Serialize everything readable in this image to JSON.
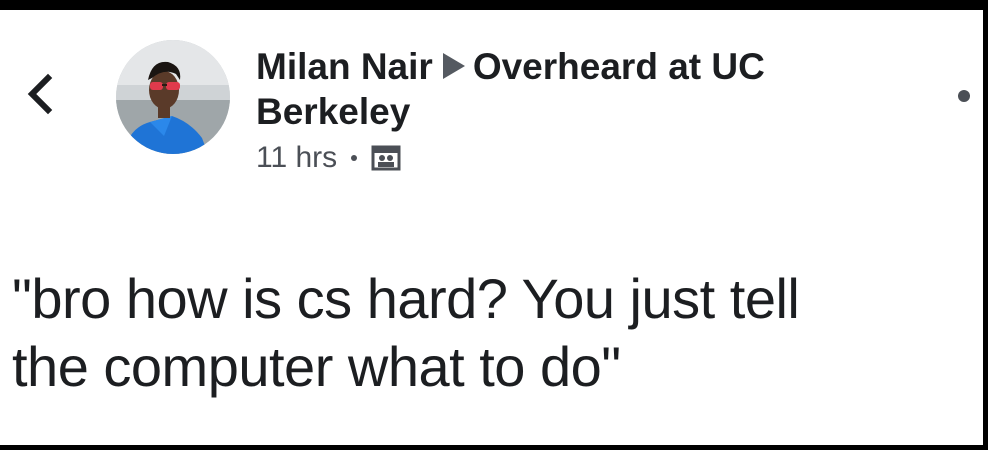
{
  "post": {
    "author": "Milan Nair",
    "group": "Overheard at UC",
    "group_line2": "Berkeley",
    "timestamp": "11 hrs",
    "audience_icon": "group-audience-icon",
    "body_line1": "\"bro how is cs hard? You just tell",
    "body_line2": "the computer what to do\""
  },
  "icons": {
    "back": "chevron-left-icon",
    "more": "more-options-icon",
    "arrow": "triangle-right-icon"
  },
  "colors": {
    "text": "#1c1e21",
    "meta": "#4b4f56",
    "background": "#ffffff",
    "frame": "#000000"
  }
}
